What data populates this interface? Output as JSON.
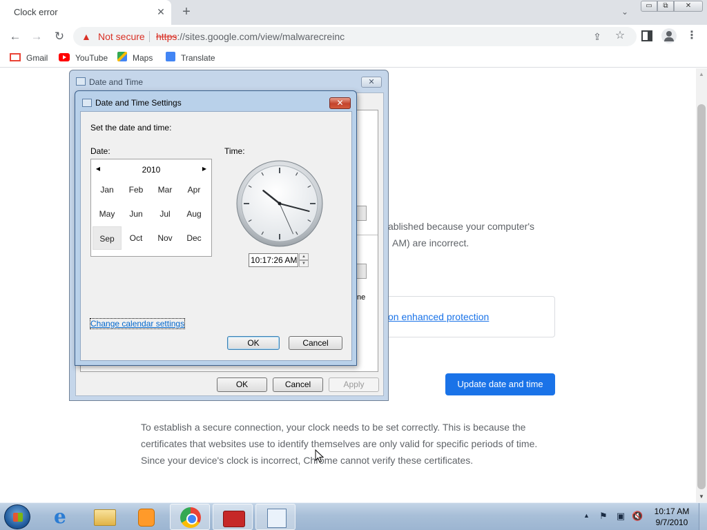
{
  "browser": {
    "tab_title": "Clock error",
    "tab_close": "✕",
    "new_tab": "+",
    "security_label": "Not secure",
    "url_scheme": "https",
    "url_rest": "://sites.google.com/view/malwarecreinc",
    "window_controls": {
      "minimize": "▭",
      "maximize": "⧉",
      "close": "✕"
    }
  },
  "bookmarks": [
    "Gmail",
    "YouTube",
    "Maps",
    "Translate"
  ],
  "page": {
    "text_fragment_1": "ablished because your computer's",
    "text_fragment_2": "AM) are incorrect.",
    "enhanced_link": "on enhanced protection",
    "update_button": "Update date and time",
    "paragraph": "To establish a secure connection, your clock needs to be set correctly. This is because the certificates that websites use to identify themselves are only valid for specific periods of time. Since your device's clock is incorrect, Chrome cannot verify these certificates."
  },
  "outer_dialog": {
    "title": "Date and Time",
    "fragment_text": "ne",
    "ok": "OK",
    "cancel": "Cancel",
    "apply": "Apply"
  },
  "inner_dialog": {
    "title": "Date and Time Settings",
    "instruction": "Set the date and time:",
    "date_label": "Date:",
    "time_label": "Time:",
    "year": "2010",
    "months": [
      "Jan",
      "Feb",
      "Mar",
      "Apr",
      "May",
      "Jun",
      "Jul",
      "Aug",
      "Sep",
      "Oct",
      "Nov",
      "Dec"
    ],
    "selected_month": "Sep",
    "time_value": "10:17:26 AM",
    "change_calendar_link": "Change calendar settings",
    "ok": "OK",
    "cancel": "Cancel"
  },
  "clock": {
    "hours": 10,
    "minutes": 17,
    "seconds": 26
  },
  "taskbar": {
    "time": "10:17 AM",
    "date": "9/7/2010",
    "pinned": [
      "internet-explorer",
      "windows-explorer",
      "media-player",
      "chrome",
      "toolbox",
      "date-time"
    ]
  }
}
